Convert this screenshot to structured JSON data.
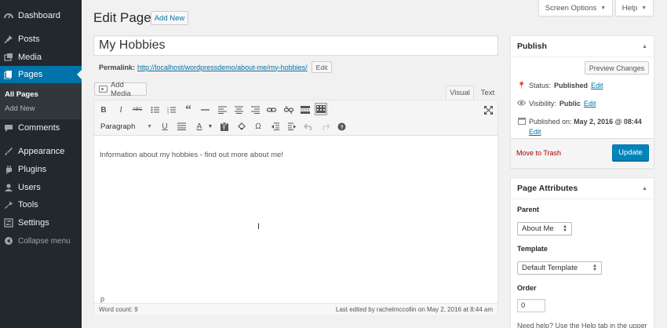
{
  "sidebar": {
    "items": [
      {
        "label": "Dashboard",
        "icon": "dashboard-icon"
      },
      {
        "label": "Posts",
        "icon": "pin-icon"
      },
      {
        "label": "Media",
        "icon": "media-icon"
      },
      {
        "label": "Pages",
        "icon": "pages-icon"
      },
      {
        "label": "Comments",
        "icon": "comment-icon"
      },
      {
        "label": "Appearance",
        "icon": "brush-icon"
      },
      {
        "label": "Plugins",
        "icon": "plugin-icon"
      },
      {
        "label": "Users",
        "icon": "user-icon"
      },
      {
        "label": "Tools",
        "icon": "wrench-icon"
      },
      {
        "label": "Settings",
        "icon": "settings-icon"
      }
    ],
    "submenu": {
      "all_pages": "All Pages",
      "add_new": "Add New"
    },
    "collapse": "Collapse menu"
  },
  "header": {
    "title": "Edit Page",
    "add_new": "Add New",
    "screen_options": "Screen Options",
    "help": "Help"
  },
  "post": {
    "title": "My Hobbies",
    "permalink_label": "Permalink:",
    "permalink_base": "http://localhost/wordpressdemo/about-me/",
    "permalink_slug": "my-hobbies",
    "permalink_trailing": "/",
    "permalink_edit": "Edit"
  },
  "editor": {
    "add_media": "Add Media",
    "tab_visual": "Visual",
    "tab_text": "Text",
    "format_value": "Paragraph",
    "content": "Information about my hobbies - find out more about me!",
    "path": "p",
    "word_count": "Word count: 9",
    "last_edited": "Last edited by rachelmccollin on May 2, 2016 at 8:44 am"
  },
  "publish": {
    "title": "Publish",
    "preview": "Preview Changes",
    "status_label": "Status:",
    "status_value": "Published",
    "visibility_label": "Visibility:",
    "visibility_value": "Public",
    "published_label": "Published on:",
    "published_value": "May 2, 2016 @ 08:44",
    "edit": "Edit",
    "trash": "Move to Trash",
    "update": "Update"
  },
  "attributes": {
    "title": "Page Attributes",
    "parent_label": "Parent",
    "parent_value": "About Me",
    "template_label": "Template",
    "template_value": "Default Template",
    "order_label": "Order",
    "order_value": "0",
    "help_text": "Need help? Use the Help tab in the upper"
  },
  "colors": {
    "sidebar_bg": "#23282d",
    "accent": "#0073aa",
    "update_button": "#0085ba",
    "trash": "#a00000"
  }
}
